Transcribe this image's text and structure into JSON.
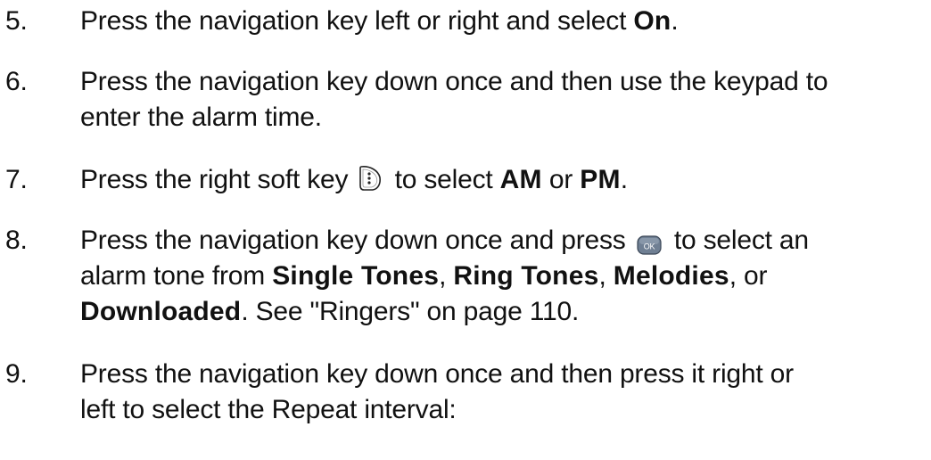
{
  "steps": [
    {
      "number": "5.",
      "text": {
        "a": "Press the navigation key left or right and select ",
        "bold1": "On",
        "b": "."
      }
    },
    {
      "number": "6.",
      "text": {
        "line1": "Press the navigation key down once and then use the keypad to",
        "line2": "enter the alarm time."
      }
    },
    {
      "number": "7.",
      "text": {
        "a": "Press the right soft key ",
        "b": " to select ",
        "bold1": "AM",
        "c": " or ",
        "bold2": "PM",
        "d": "."
      },
      "icon": "right-soft-key-icon"
    },
    {
      "number": "8.",
      "text": {
        "a": "Press the navigation key down once and press ",
        "b": " to select an",
        "c": "alarm tone from ",
        "bold1": "Single Tones",
        "d": ", ",
        "bold2": "Ring Tones",
        "e": ", ",
        "bold3": "Melodies",
        "f": ", or",
        "bold4": "Downloaded",
        "g": ". See \"Ringers\" on page 110."
      },
      "icon": "ok-key-icon",
      "icon_label": "OK"
    },
    {
      "number": "9.",
      "text": {
        "line1": "Press the navigation key down once and then press it right or",
        "line2": "left to select the Repeat interval:"
      }
    }
  ],
  "colors": {
    "text": "#111111",
    "ok_key": "#6f7f93"
  }
}
